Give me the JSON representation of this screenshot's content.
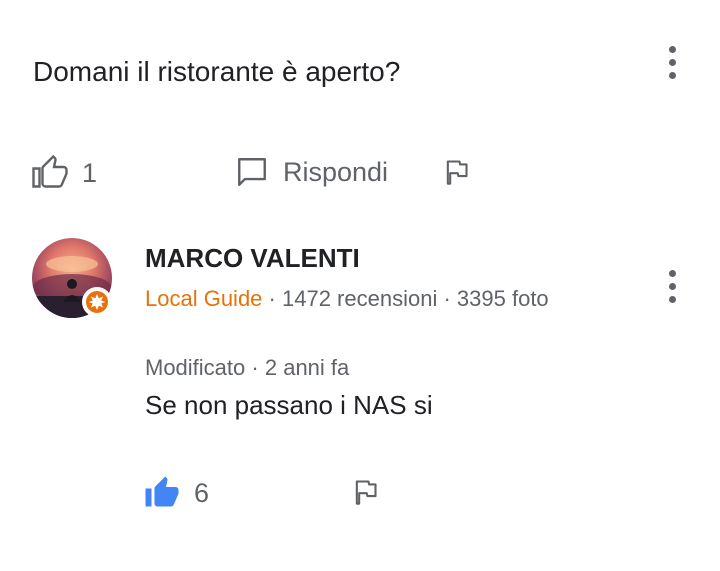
{
  "question": {
    "text": "Domani il ristorante è aperto?",
    "like_count": "1",
    "reply_label": "Rispondi"
  },
  "answer": {
    "author": "MARCO VALENTI",
    "badge": "Local Guide",
    "reviews": "1472 recensioni",
    "photos": "3395 foto",
    "edited_label": "Modificato",
    "time": "2 anni fa",
    "text": "Se non passano i NAS si",
    "like_count": "6"
  },
  "colors": {
    "accent_orange": "#e8710a",
    "like_active_blue": "#4285f4",
    "text_primary": "#202124",
    "text_secondary": "#5f6368"
  },
  "icons": {
    "question_like": "thumb-up-outline-icon",
    "reply": "chat-bubble-icon",
    "flag": "flag-icon",
    "more": "more-vert-icon",
    "answer_like": "thumb-up-filled-icon",
    "guide_badge": "local-guide-star-icon"
  }
}
